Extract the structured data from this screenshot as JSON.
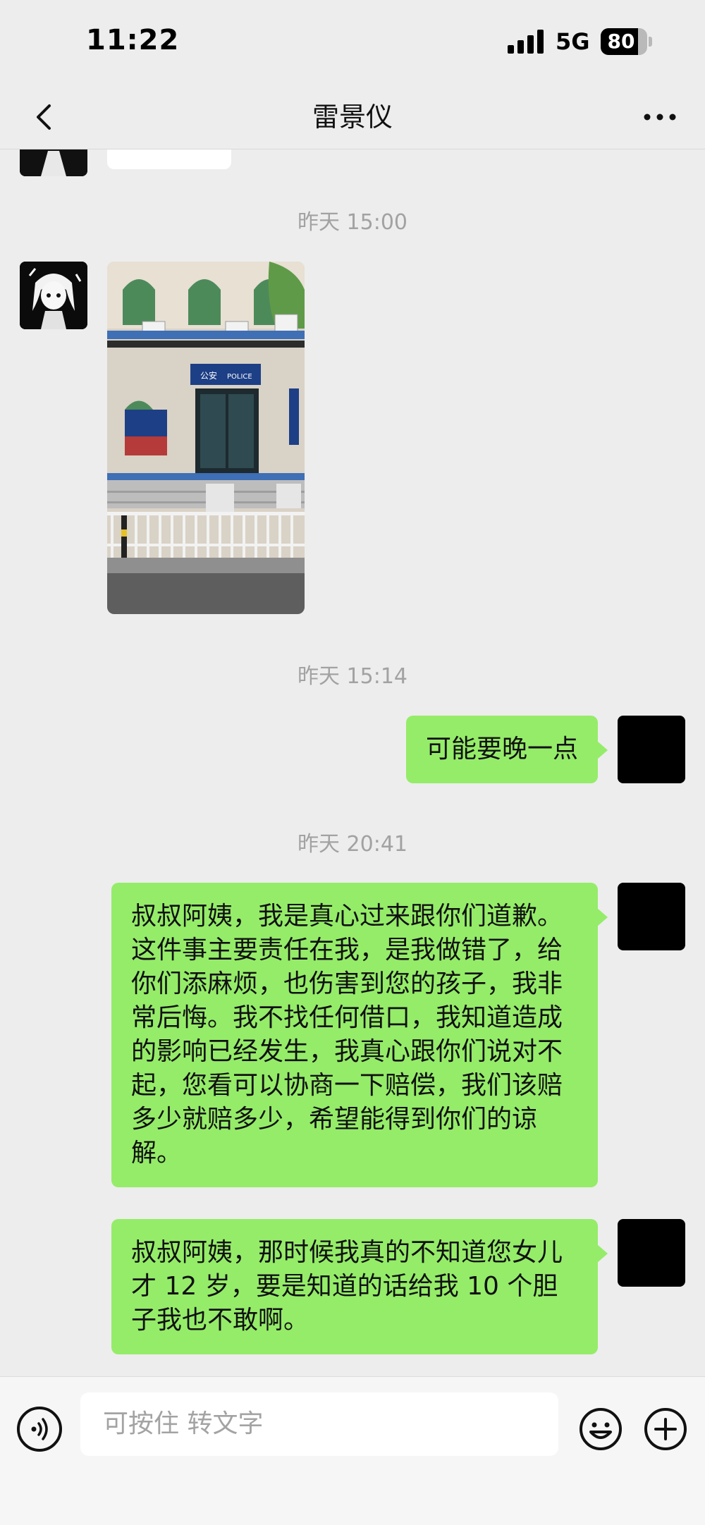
{
  "status": {
    "time": "11:22",
    "network": "5G",
    "battery": "80",
    "battery_level": 0.8
  },
  "nav": {
    "title": "雷景仪",
    "back_icon": "chevron-left-icon",
    "more_icon": "more-dots-icon"
  },
  "timestamps": [
    "昨天 15:00",
    "昨天 15:14",
    "昨天 20:41"
  ],
  "photo": {
    "sign_text": "公安",
    "sign_text_en": "POLICE"
  },
  "messages": [
    {
      "side": "right",
      "text": "可能要晚一点"
    },
    {
      "side": "right",
      "text": "叔叔阿姨，我是真心过来跟你们道歉。这件事主要责任在我，是我做错了，给你们添麻烦，也伤害到您的孩子，我非常后悔。我不找任何借口，我知道造成的影响已经发生，我真心跟你们说对不起，您看可以协商一下赔偿，我们该赔多少就赔多少，希望能得到你们的谅解。"
    },
    {
      "side": "right",
      "text": "叔叔阿姨，那时候我真的不知道您女儿才 12 岁，要是知道的话给我 10 个胆子我也不敢啊。"
    }
  ],
  "input": {
    "placeholder": "可按住 转文字",
    "voice_icon": "voice-icon",
    "emoji_icon": "emoji-icon",
    "plus_icon": "plus-icon"
  },
  "colors": {
    "background": "#ededed",
    "bubble_sent": "#95ec69",
    "timestamp": "#a2a2a2"
  }
}
